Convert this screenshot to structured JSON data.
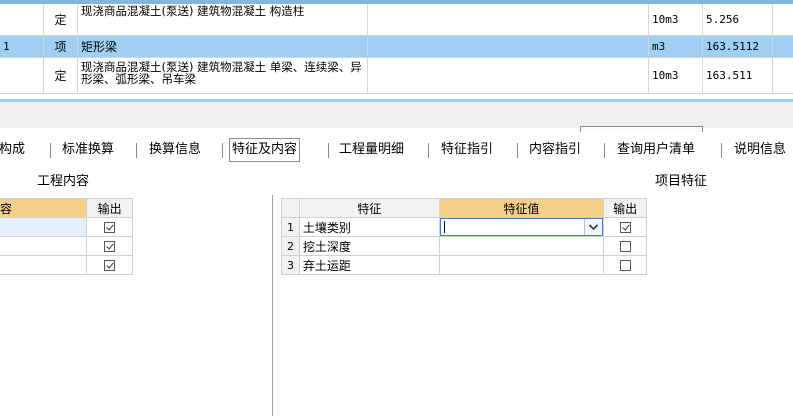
{
  "grid": {
    "rows": [
      {
        "code": "",
        "type": "定",
        "desc": "现浇商品混凝土(泵送) 建筑物混凝土  构造柱",
        "unit": "10m3",
        "qty": "5.256",
        "selected": false
      },
      {
        "code": "1",
        "type": "项",
        "desc": "矩形梁",
        "unit": "m3",
        "qty": "163.5112",
        "selected": true
      },
      {
        "code": "",
        "type": "定",
        "desc": "现浇商品混凝土(泵送) 建筑物混凝土  单梁、连续梁、异形梁、弧形梁、吊车梁",
        "unit": "10m3",
        "qty": "163.511",
        "selected": false
      }
    ]
  },
  "tabs": [
    {
      "label": "构成",
      "active": false
    },
    {
      "label": "标准换算",
      "active": false
    },
    {
      "label": "换算信息",
      "active": false
    },
    {
      "label": "特征及内容",
      "active": true
    },
    {
      "label": "工程量明细",
      "active": false
    },
    {
      "label": "特征指引",
      "active": false
    },
    {
      "label": "内容指引",
      "active": false
    },
    {
      "label": "查询用户清单",
      "active": false
    },
    {
      "label": "说明信息",
      "active": false
    }
  ],
  "sections": {
    "work_content": "工程内容",
    "item_features": "项目特征"
  },
  "left_table": {
    "headers": [
      "容",
      "输出"
    ],
    "rows": [
      {
        "name": "",
        "output": true
      },
      {
        "name": "",
        "output": true
      },
      {
        "name": "",
        "output": true
      }
    ]
  },
  "right_table": {
    "headers": [
      "特征",
      "特征值",
      "输出"
    ],
    "rows": [
      {
        "no": "1",
        "feature": "土壤类别",
        "value": "",
        "output": true
      },
      {
        "no": "2",
        "feature": "挖土深度",
        "value": "",
        "output": false
      },
      {
        "no": "3",
        "feature": "弃土运距",
        "value": "",
        "output": false
      }
    ]
  },
  "icons": {
    "dropdown": "chevron-down-icon",
    "checkbox": "checkbox-icon"
  },
  "colors": {
    "selected_row": "#9fd0f4",
    "header_highlight": "#f4cf8a",
    "dropdown_border": "#3a7bd5"
  }
}
